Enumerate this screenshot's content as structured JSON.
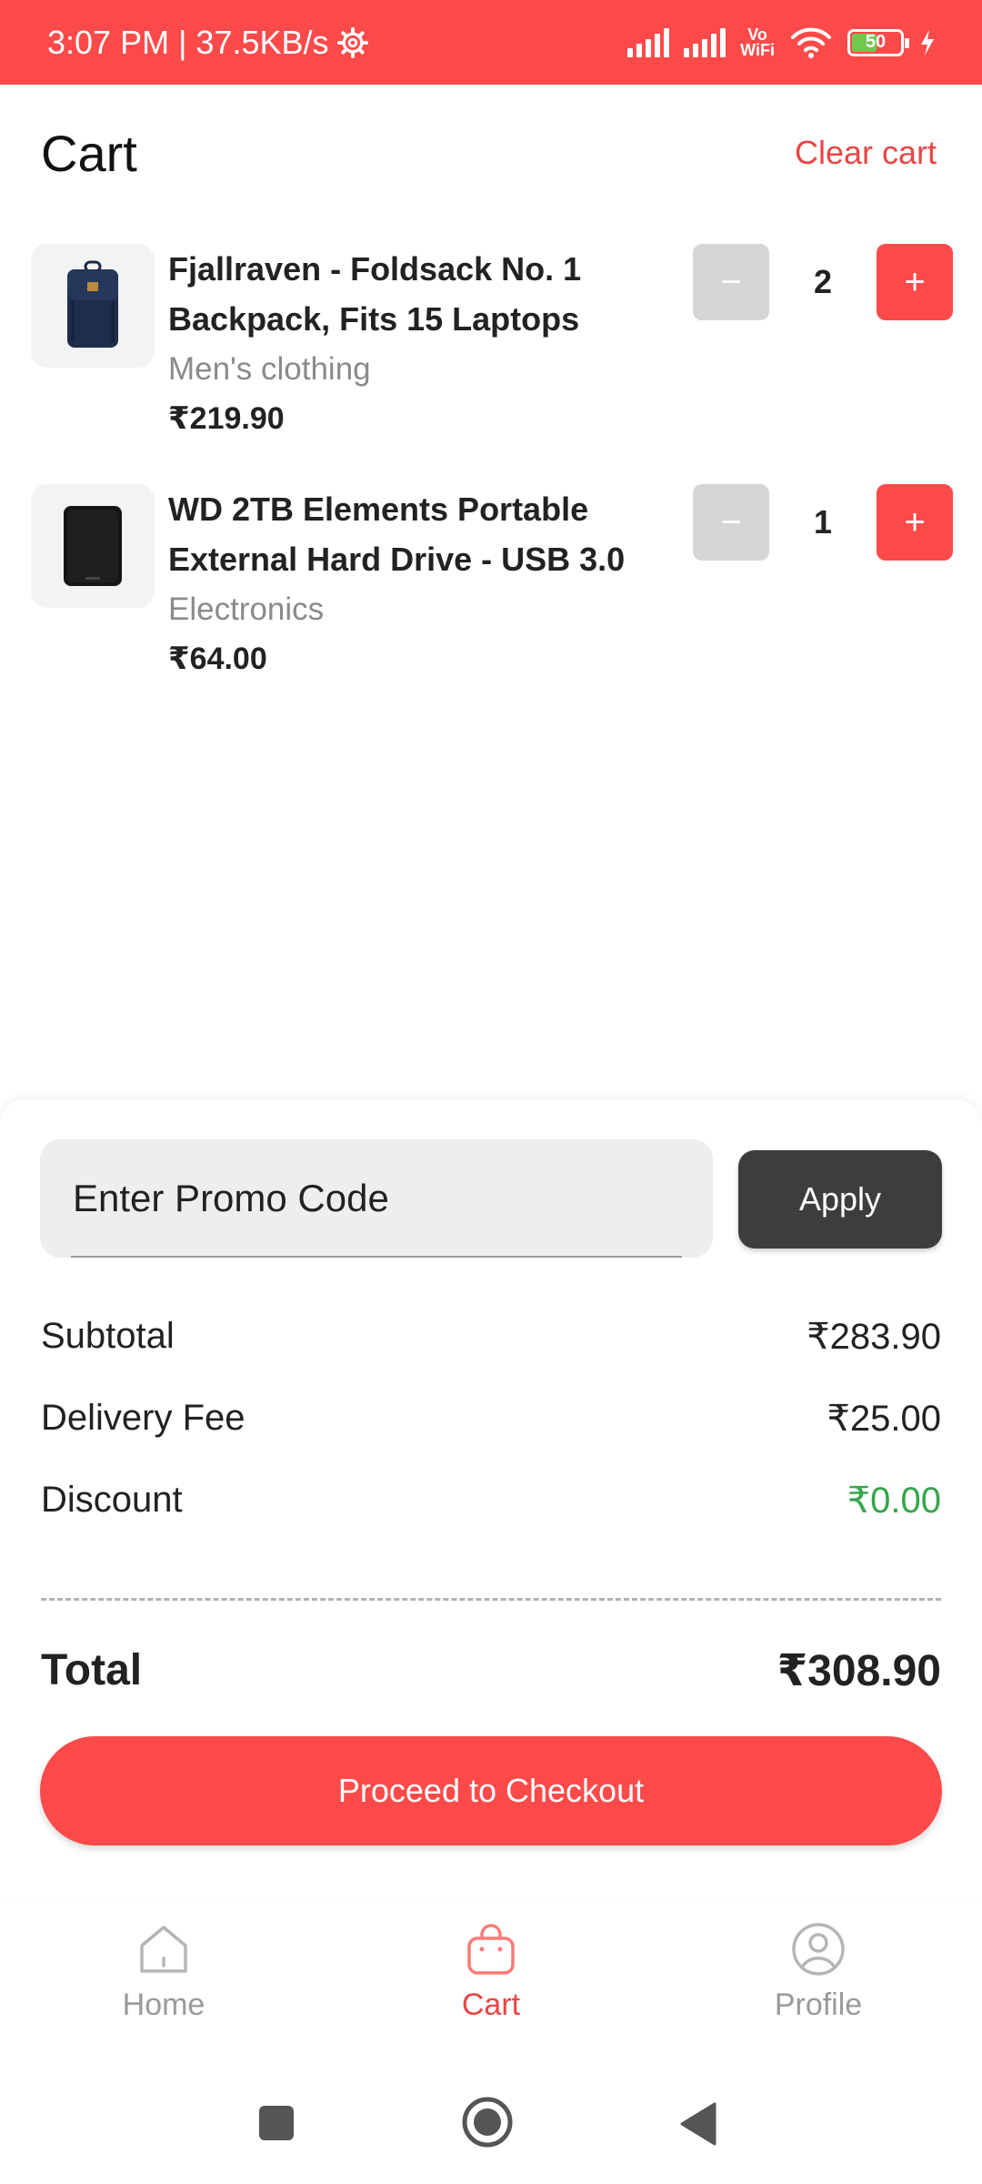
{
  "status_bar": {
    "time_speed": "3:07 PM | 37.5KB/s",
    "wifi_label_top": "Vo",
    "wifi_label_bottom": "WiFi",
    "battery_level": "50"
  },
  "header": {
    "title": "Cart",
    "clear_label": "Clear cart"
  },
  "cart": {
    "items": [
      {
        "title": "Fjallraven - Foldsack No. 1 Backpack, Fits 15 Laptops",
        "category": "Men's clothing",
        "price": "₹219.90",
        "quantity": "2",
        "image_icon": "backpack-icon"
      },
      {
        "title": "WD 2TB Elements Portable External Hard Drive - USB 3.0",
        "category": "Electronics",
        "price": "₹64.00",
        "quantity": "1",
        "image_icon": "hard-drive-icon"
      }
    ],
    "minus_symbol": "−",
    "plus_symbol": "+"
  },
  "summary": {
    "promo_placeholder": "Enter Promo Code",
    "apply_label": "Apply",
    "subtotal_label": "Subtotal",
    "subtotal_value": "₹283.90",
    "delivery_label": "Delivery Fee",
    "delivery_value": "₹25.00",
    "discount_label": "Discount",
    "discount_value": "₹0.00",
    "total_label": "Total",
    "total_value": "₹308.90",
    "checkout_label": "Proceed to Checkout"
  },
  "nav": {
    "home_label": "Home",
    "cart_label": "Cart",
    "profile_label": "Profile",
    "active": "cart"
  },
  "colors": {
    "accent": "#fc4a4a",
    "discount": "#36a64a",
    "apply_bg": "#3d3d3d"
  }
}
